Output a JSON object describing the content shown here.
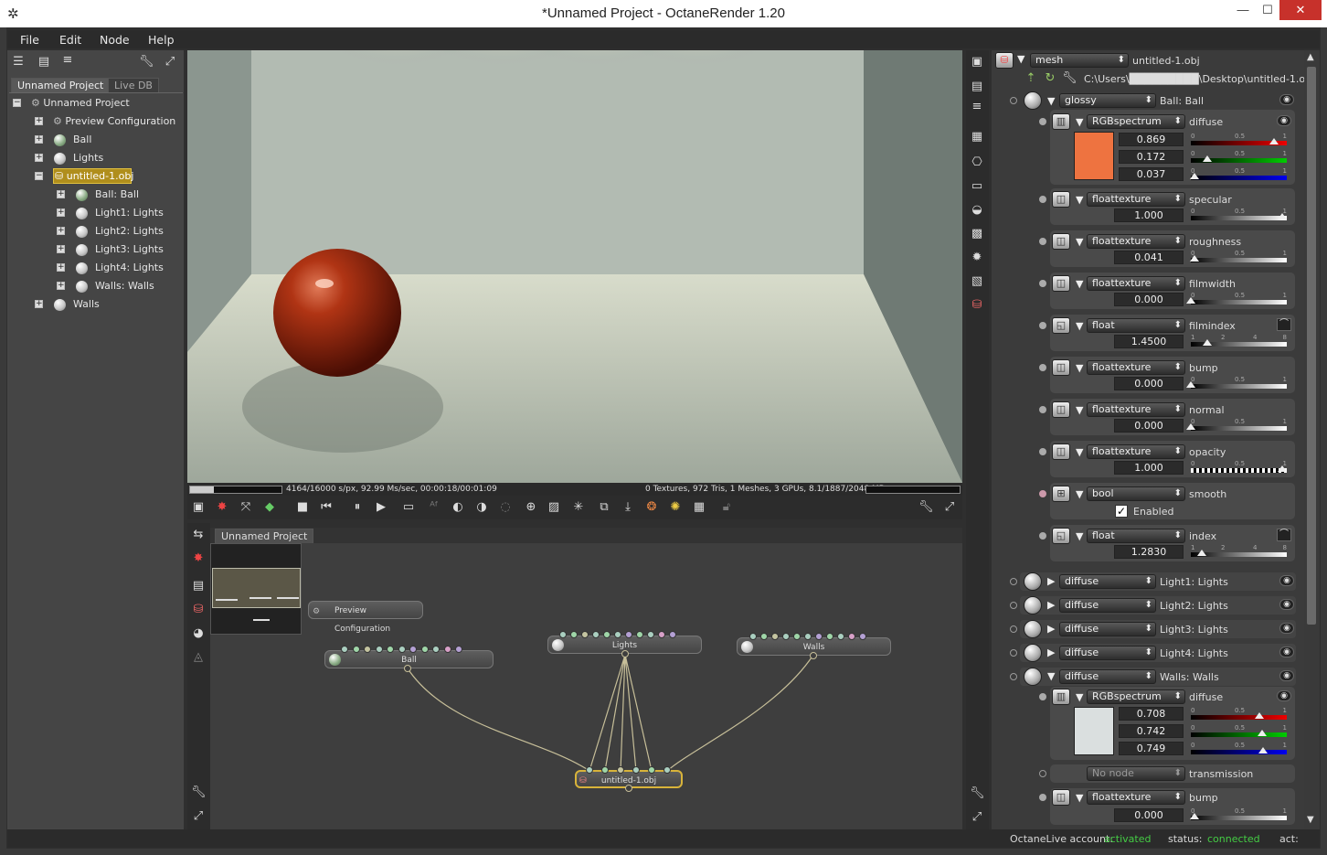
{
  "window": {
    "title": "*Unnamed Project - OctaneRender 1.20",
    "minimize": "—",
    "maximize": "☐",
    "close": "✕"
  },
  "menu": [
    "File",
    "Edit",
    "Node",
    "Help"
  ],
  "scene": {
    "tabs": [
      "Unnamed Project",
      "Live DB"
    ],
    "tree": [
      {
        "label": "Unnamed Project",
        "icon": "project-icon"
      },
      {
        "label": "Preview Configuration",
        "icon": "config-icon"
      },
      {
        "label": "Ball",
        "icon": "sphere-icon"
      },
      {
        "label": "Lights",
        "icon": "sphere-icon"
      },
      {
        "label": "untitled-1.obj",
        "icon": "mesh-icon"
      },
      {
        "label": "Ball: Ball",
        "icon": "sphere-icon"
      },
      {
        "label": "Light1: Lights",
        "icon": "sphere-icon"
      },
      {
        "label": "Light2: Lights",
        "icon": "sphere-icon"
      },
      {
        "label": "Light3: Lights",
        "icon": "sphere-icon"
      },
      {
        "label": "Light4: Lights",
        "icon": "sphere-icon"
      },
      {
        "label": "Walls: Walls",
        "icon": "sphere-icon"
      },
      {
        "label": "Walls",
        "icon": "sphere-icon"
      }
    ]
  },
  "render": {
    "stats_left": "4164/16000 s/px, 92.99 Ms/sec, 00:00:18/00:01:09",
    "stats_right": "0 Textures, 972 Tris, 1 Meshes, 3 GPUs, 8.1/1887/2048 MB",
    "progress": 0.26
  },
  "graph": {
    "tab": "Unnamed Project",
    "nodes": {
      "preview": "Preview Configuration",
      "ball": "Ball",
      "lights": "Lights",
      "walls": "Walls",
      "mesh": "untitled-1.obj"
    }
  },
  "inspector": {
    "node_type": "mesh",
    "node_name": "untitled-1.obj",
    "path": "C:\\Users\\█████████\\Desktop\\untitled-1.obj",
    "material_type": "glossy",
    "material_name": "Ball: Ball",
    "diffuse": {
      "type": "RGBspectrum",
      "name": "diffuse",
      "r": "0.869",
      "g": "0.172",
      "b": "0.037",
      "swatch": "#ee7340"
    },
    "params": [
      {
        "type": "floattexture",
        "name": "specular",
        "value": "1.000"
      },
      {
        "type": "floattexture",
        "name": "roughness",
        "value": "0.041"
      },
      {
        "type": "floattexture",
        "name": "filmwidth",
        "value": "0.000"
      },
      {
        "type": "float",
        "name": "filmindex",
        "value": "1.4500"
      },
      {
        "type": "floattexture",
        "name": "bump",
        "value": "0.000"
      },
      {
        "type": "floattexture",
        "name": "normal",
        "value": "0.000"
      },
      {
        "type": "floattexture",
        "name": "opacity",
        "value": "1.000"
      },
      {
        "type": "bool",
        "name": "smooth",
        "value": "Enabled"
      },
      {
        "type": "float",
        "name": "index",
        "value": "1.2830"
      }
    ],
    "ticks": {
      "a": "0",
      "b": "0.5",
      "c": "1",
      "i1": "1",
      "i2": "2",
      "i4": "4",
      "i8": "8"
    },
    "materials": [
      {
        "type": "diffuse",
        "name": "Light1: Lights"
      },
      {
        "type": "diffuse",
        "name": "Light2: Lights"
      },
      {
        "type": "diffuse",
        "name": "Light3: Lights"
      },
      {
        "type": "diffuse",
        "name": "Light4: Lights"
      },
      {
        "type": "diffuse",
        "name": "Walls: Walls"
      }
    ],
    "walls_diffuse": {
      "type": "RGBspectrum",
      "name": "diffuse",
      "r": "0.708",
      "g": "0.742",
      "b": "0.749",
      "swatch": "#dadfdf"
    },
    "transmission": {
      "type": "No node",
      "name": "transmission"
    },
    "walls_bump": {
      "type": "floattexture",
      "name": "bump",
      "value": "0.000"
    }
  },
  "status": {
    "account_label": "OctaneLive account:",
    "account_value": "activated",
    "status_label": "status:",
    "status_value": "connected",
    "act_label": "act:"
  }
}
